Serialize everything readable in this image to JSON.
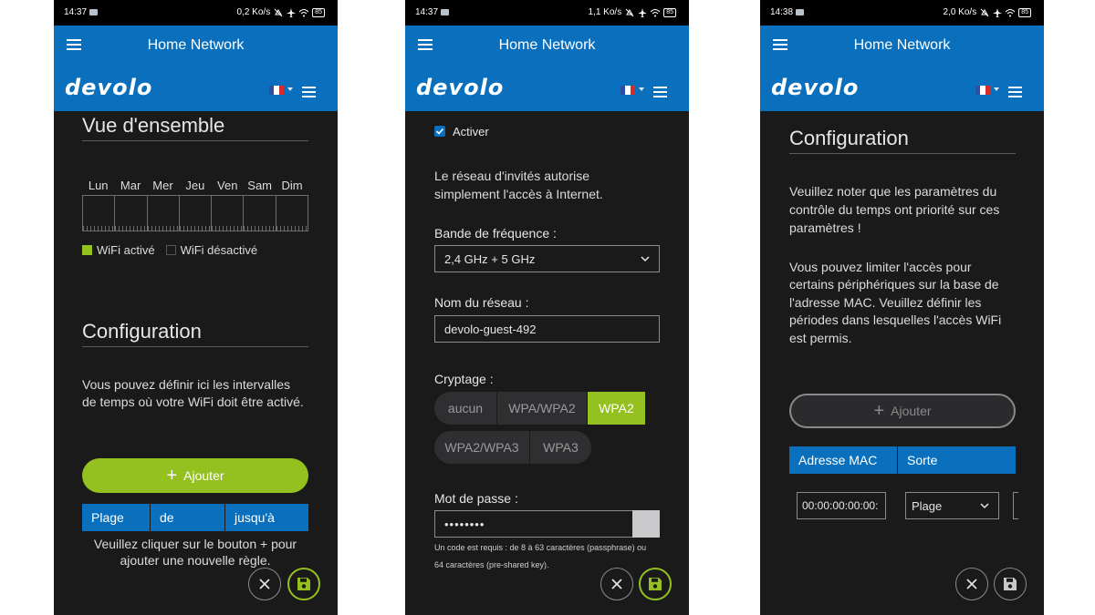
{
  "screen1": {
    "status": {
      "time": "14:37",
      "speed": "0,2 Ko/s",
      "battery": "85"
    },
    "app_title": "Home Network",
    "logo": "devolo",
    "overview_title": "Vue d'ensemble",
    "days": [
      "Lun",
      "Mar",
      "Mer",
      "Jeu",
      "Ven",
      "Sam",
      "Dim"
    ],
    "legend": {
      "on": "WiFi activé",
      "off": "WiFi désactivé",
      "on_color": "#94c11f"
    },
    "config_title": "Configuration",
    "config_text_1": "Vous pouvez définir ici les intervalles",
    "config_text_2": "de temps où votre WiFi doit être activé.",
    "add_button": "Ajouter",
    "table_headers": [
      "Plage",
      "de",
      "jusqu'à"
    ],
    "empty_line_1": "Veuillez cliquer sur le bouton + pour",
    "empty_line_2": "ajouter une nouvelle règle."
  },
  "screen2": {
    "status": {
      "time": "14:37",
      "speed": "1,1 Ko/s",
      "battery": "85"
    },
    "app_title": "Home Network",
    "logo": "devolo",
    "enable_label": "Activer",
    "enable_checked": true,
    "guest_text_1": "Le réseau d'invités autorise",
    "guest_text_2": "simplement l'accès à Internet.",
    "band_label": "Bande de fréquence :",
    "band_value": "2,4 GHz + 5 GHz",
    "ssid_label": "Nom du réseau :",
    "ssid_value": "devolo-guest-492",
    "crypto_label": "Cryptage :",
    "crypto_options": [
      "aucun",
      "WPA/WPA2",
      "WPA2",
      "WPA2/WPA3",
      "WPA3"
    ],
    "crypto_selected": "WPA2",
    "password_label": "Mot de passe :",
    "password_value": "••••••••",
    "password_hint_1": "Un code est requis : de 8 à 63 caractères (passphrase) ou",
    "password_hint_2": "64 caractères (pre-shared key)."
  },
  "screen3": {
    "status": {
      "time": "14:38",
      "speed": "2,0 Ko/s",
      "battery": "85"
    },
    "app_title": "Home Network",
    "logo": "devolo",
    "config_title": "Configuration",
    "note_1": "Veuillez noter que les paramètres du",
    "note_2": "contrôle du temps ont priorité sur ces",
    "note_3": "paramètres !",
    "info_1": "Vous pouvez limiter l'accès pour",
    "info_2": "certains périphériques sur la base de",
    "info_3": "l'adresse MAC. Veuillez définir les",
    "info_4": "périodes dans lesquelles l'accès WiFi",
    "info_5": "est permis.",
    "add_button": "Ajouter",
    "table_headers": [
      "Adresse MAC",
      "Sorte"
    ],
    "mac_value": "00:00:00:00:00:",
    "type_value": "Plage"
  },
  "colors": {
    "accent_blue": "#0a70bd",
    "accent_green": "#94c11f",
    "background": "#1a1a1b"
  }
}
